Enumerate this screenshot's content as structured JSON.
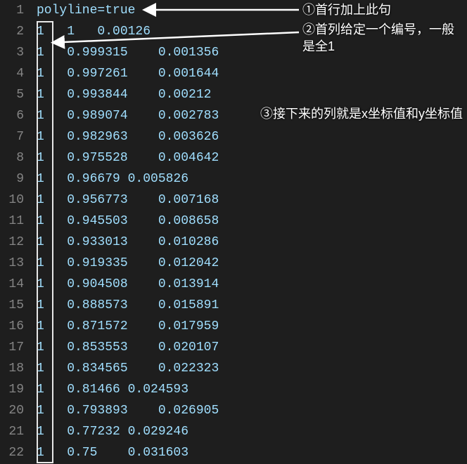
{
  "first_line": "polyline=true",
  "rows": [
    {
      "ln": 1,
      "text": "polyline=true"
    },
    {
      "ln": 2,
      "text": "1   1   0.00126"
    },
    {
      "ln": 3,
      "text": "1   0.999315    0.001356"
    },
    {
      "ln": 4,
      "text": "1   0.997261    0.001644"
    },
    {
      "ln": 5,
      "text": "1   0.993844    0.00212"
    },
    {
      "ln": 6,
      "text": "1   0.989074    0.002783"
    },
    {
      "ln": 7,
      "text": "1   0.982963    0.003626"
    },
    {
      "ln": 8,
      "text": "1   0.975528    0.004642"
    },
    {
      "ln": 9,
      "text": "1   0.96679 0.005826"
    },
    {
      "ln": 10,
      "text": "1   0.956773    0.007168"
    },
    {
      "ln": 11,
      "text": "1   0.945503    0.008658"
    },
    {
      "ln": 12,
      "text": "1   0.933013    0.010286"
    },
    {
      "ln": 13,
      "text": "1   0.919335    0.012042"
    },
    {
      "ln": 14,
      "text": "1   0.904508    0.013914"
    },
    {
      "ln": 15,
      "text": "1   0.888573    0.015891"
    },
    {
      "ln": 16,
      "text": "1   0.871572    0.017959"
    },
    {
      "ln": 17,
      "text": "1   0.853553    0.020107"
    },
    {
      "ln": 18,
      "text": "1   0.834565    0.022323"
    },
    {
      "ln": 19,
      "text": "1   0.81466 0.024593"
    },
    {
      "ln": 20,
      "text": "1   0.793893    0.026905"
    },
    {
      "ln": 21,
      "text": "1   0.77232 0.029246"
    },
    {
      "ln": 22,
      "text": "1   0.75    0.031603"
    }
  ],
  "chart_data": {
    "type": "table",
    "columns": [
      "id",
      "x",
      "y"
    ],
    "data": [
      {
        "id": 1,
        "x": 1,
        "y": 0.00126
      },
      {
        "id": 1,
        "x": 0.999315,
        "y": 0.001356
      },
      {
        "id": 1,
        "x": 0.997261,
        "y": 0.001644
      },
      {
        "id": 1,
        "x": 0.993844,
        "y": 0.00212
      },
      {
        "id": 1,
        "x": 0.989074,
        "y": 0.002783
      },
      {
        "id": 1,
        "x": 0.982963,
        "y": 0.003626
      },
      {
        "id": 1,
        "x": 0.975528,
        "y": 0.004642
      },
      {
        "id": 1,
        "x": 0.96679,
        "y": 0.005826
      },
      {
        "id": 1,
        "x": 0.956773,
        "y": 0.007168
      },
      {
        "id": 1,
        "x": 0.945503,
        "y": 0.008658
      },
      {
        "id": 1,
        "x": 0.933013,
        "y": 0.010286
      },
      {
        "id": 1,
        "x": 0.919335,
        "y": 0.012042
      },
      {
        "id": 1,
        "x": 0.904508,
        "y": 0.013914
      },
      {
        "id": 1,
        "x": 0.888573,
        "y": 0.015891
      },
      {
        "id": 1,
        "x": 0.871572,
        "y": 0.017959
      },
      {
        "id": 1,
        "x": 0.853553,
        "y": 0.020107
      },
      {
        "id": 1,
        "x": 0.834565,
        "y": 0.022323
      },
      {
        "id": 1,
        "x": 0.81466,
        "y": 0.024593
      },
      {
        "id": 1,
        "x": 0.793893,
        "y": 0.026905
      },
      {
        "id": 1,
        "x": 0.77232,
        "y": 0.029246
      },
      {
        "id": 1,
        "x": 0.75,
        "y": 0.031603
      }
    ]
  },
  "annotations": {
    "a1": "①首行加上此句",
    "a2": "②首列给定一个编号，一般是全1",
    "a3": "③接下来的列就是x坐标值和y坐标值"
  }
}
